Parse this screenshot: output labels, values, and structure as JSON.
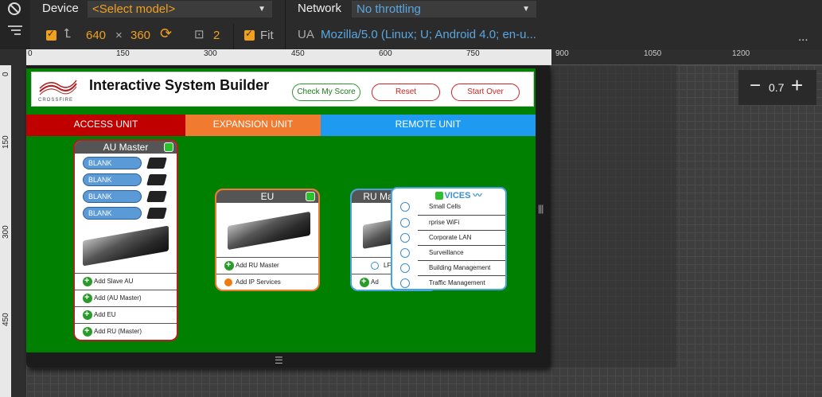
{
  "toolbar": {
    "device_label": "Device",
    "device_select": "<Select model>",
    "network_label": "Network",
    "network_select": "No throttling",
    "width": "640",
    "times": "×",
    "height": "360",
    "dpr": "2",
    "fit_label": "Fit",
    "ua_label": "UA",
    "ua_value": "Mozilla/5.0 (Linux; U; Android 4.0; en-u...",
    "more": "..."
  },
  "ruler": {
    "top_ticks": [
      "0",
      "150",
      "300",
      "450",
      "600",
      "750",
      "900",
      "1050",
      "1200"
    ],
    "left_ticks": [
      "0",
      "150",
      "300",
      "450"
    ]
  },
  "zoom": {
    "minus": "−",
    "value": "0.7",
    "plus": "+"
  },
  "app": {
    "logo_text": "CROSSFIRE",
    "title": "Interactive System Builder",
    "buttons": {
      "check": "Check My Score",
      "reset": "Reset",
      "start_over": "Start Over"
    },
    "tabs": [
      {
        "label": "ACCESS UNIT",
        "color": "#c00000"
      },
      {
        "label": "EXPANSION UNIT",
        "color": "#f07a30"
      },
      {
        "label": "REMOTE UNIT",
        "color": "#1e9af0"
      }
    ],
    "au": {
      "title": "AU Master",
      "blanks": [
        "BLANK",
        "BLANK",
        "BLANK",
        "BLANK"
      ],
      "actions": [
        "Add Slave AU",
        "Add (AU Master)",
        "Add EU",
        "Add RU (Master)"
      ]
    },
    "eu": {
      "title": "EU",
      "actions": [
        "Add RU Master",
        "Add IP Services"
      ]
    },
    "ru": {
      "title": "RU Master",
      "partial_row_1": "LF",
      "partial_row_2": "Ad"
    },
    "popup": {
      "title": "IP SERVICES",
      "visible_title": "VICES",
      "items": [
        "Small Cells",
        "Enterprise WiFi",
        "Corporate LAN",
        "Surveillance",
        "Building Management",
        "Traffic Management"
      ],
      "visible_items": [
        "Small Cells",
        "rprise WiFi",
        "Corporate LAN",
        "Surveillance",
        "Building Management",
        "Traffic Management"
      ]
    }
  }
}
